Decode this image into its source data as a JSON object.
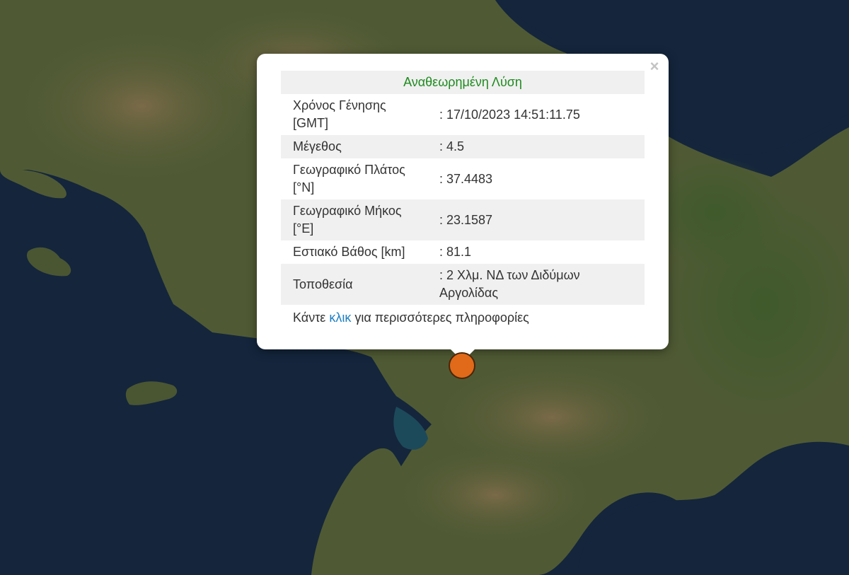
{
  "map": {
    "colors": {
      "sea": "#14253c",
      "land": "#4f5a34",
      "mountains": "#6b5c3f",
      "marker_fill": "#e06a1a",
      "marker_border": "#4a2608"
    }
  },
  "popup": {
    "close_symbol": "×",
    "header": "Αναθεωρημένη Λύση",
    "rows": [
      {
        "label": "Χρόνος Γένησης [GMT]",
        "value": ": 17/10/2023 14:51:11.75"
      },
      {
        "label": "Μέγεθος",
        "value": ": 4.5"
      },
      {
        "label": "Γεωγραφικό Πλάτος [°N]",
        "value": ": 37.4483"
      },
      {
        "label": "Γεωγραφικό Μήκος [°E]",
        "value": ": 23.1587"
      },
      {
        "label": "Εστιακό Βάθος [km]",
        "value": ": 81.1"
      },
      {
        "label": "Τοποθεσία",
        "value": ": 2 Χλμ. ΝΔ των Διδύμων Αργολίδας"
      }
    ],
    "footer": {
      "prefix": "Κάντε ",
      "link": "κλικ",
      "suffix": " για περισσότερες πληροφορίες"
    },
    "colors": {
      "header_text": "#1f8a1f",
      "link_text": "#1e7fc4"
    }
  }
}
